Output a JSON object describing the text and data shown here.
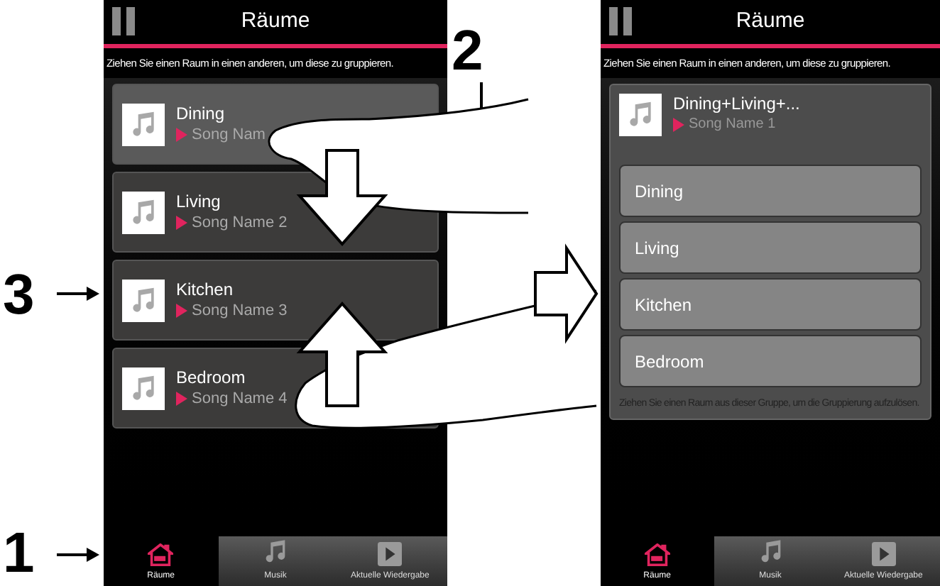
{
  "callouts": [
    {
      "label": "1"
    },
    {
      "label": "2"
    },
    {
      "label": "3"
    }
  ],
  "screens": [
    {
      "kind": "list",
      "title": "Räume",
      "hint": "Ziehen Sie einen Raum in einen anderen, um diese zu gruppieren.",
      "rooms": [
        {
          "name": "Dining",
          "song": "Song Nam"
        },
        {
          "name": "Living",
          "song": "Song Name 2"
        },
        {
          "name": "Kitchen",
          "song": "Song Name 3"
        },
        {
          "name": "Bedroom",
          "song": "Song Name 4"
        }
      ],
      "tabs": [
        {
          "label": "Räume",
          "selected": true
        },
        {
          "label": "Musik",
          "selected": false
        },
        {
          "label": "Aktuelle Wiedergabe",
          "selected": false
        }
      ]
    },
    {
      "kind": "group",
      "title": "Räume",
      "hint": "Ziehen Sie einen Raum in einen anderen, um diese zu gruppieren.",
      "group": {
        "name": "Dining+Living+...",
        "song": "Song Name 1",
        "members": [
          "Dining",
          "Living",
          "Kitchen",
          "Bedroom"
        ],
        "hint": "Ziehen Sie einen Raum aus dieser Gruppe, um die Gruppierung aufzulösen."
      },
      "tabs": [
        {
          "label": "Räume",
          "selected": true
        },
        {
          "label": "Musik",
          "selected": false
        },
        {
          "label": "Aktuelle Wiedergabe",
          "selected": false
        }
      ]
    }
  ]
}
